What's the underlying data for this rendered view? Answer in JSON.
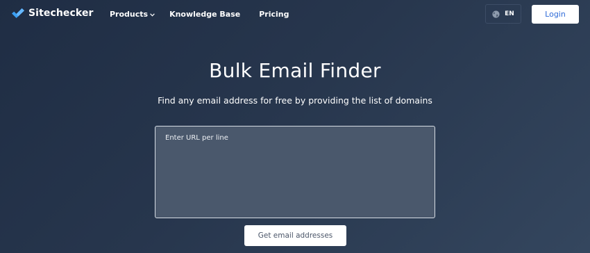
{
  "brand": {
    "name": "Sitechecker",
    "logo_icon": "checkmark-logo-icon",
    "accent_color": "#3b9ff2"
  },
  "nav": {
    "items": [
      {
        "label": "Products",
        "has_dropdown": true
      },
      {
        "label": "Knowledge Base",
        "has_dropdown": false
      },
      {
        "label": "Pricing",
        "has_dropdown": false
      }
    ]
  },
  "language": {
    "icon": "globe-icon",
    "label": "EN"
  },
  "login": {
    "label": "Login",
    "color": "#2f6bd8"
  },
  "main": {
    "title": "Bulk Email Finder",
    "subtitle": "Find any email address for free by providing the list of domains",
    "url_input": {
      "placeholder": "Enter URL per line",
      "value": ""
    },
    "submit_label": "Get email addresses"
  }
}
